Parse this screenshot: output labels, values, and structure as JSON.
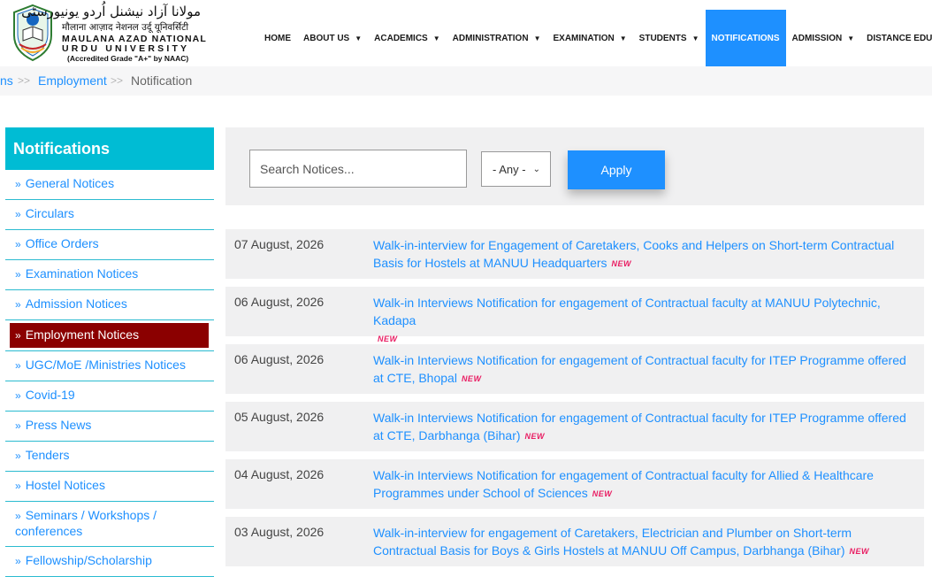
{
  "logo": {
    "urdu": "مولانا آزاد نیشنل اُردو یونیورسٹی",
    "hindi": "मौलाना आज़ाद नेशनल उर्दू यूनिवर्सिटी",
    "line1": "MAULANA AZAD NATIONAL",
    "line2": "URDU UNIVERSITY",
    "line3": "(Accredited Grade \"A+\" by NAAC)"
  },
  "nav": [
    {
      "label": "HOME",
      "dropdown": false
    },
    {
      "label": "ABOUT US",
      "dropdown": true
    },
    {
      "label": "ACADEMICS",
      "dropdown": true
    },
    {
      "label": "ADMINISTRATION",
      "dropdown": true
    },
    {
      "label": "EXAMINATION",
      "dropdown": true
    },
    {
      "label": "STUDENTS",
      "dropdown": true
    },
    {
      "label": "NOTIFICATIONS",
      "dropdown": false,
      "active": true
    },
    {
      "label": "ADMISSION",
      "dropdown": true
    },
    {
      "label": "DISTANCE EDUCATION",
      "dropdown": false
    }
  ],
  "breadcrumb": {
    "partial": "ns",
    "sep": ">>",
    "parent": "Employment",
    "current": "Notification"
  },
  "sidebar": {
    "title": "Notifications",
    "items": [
      "General Notices",
      "Circulars",
      "Office Orders",
      "Examination Notices",
      "Admission Notices",
      "Employment Notices",
      "UGC/MoE /Ministries Notices",
      "Covid-19",
      "Press News",
      "Tenders",
      "Hostel Notices",
      "Seminars / Workshops / conferences",
      "Fellowship/Scholarship"
    ],
    "active_index": 5
  },
  "filter": {
    "search_placeholder": "Search Notices...",
    "select_value": "- Any -",
    "apply_label": "Apply"
  },
  "new_badge": "NEW",
  "notices": [
    {
      "date": "07 August, 2026",
      "title": "Walk-in-interview for Engagement of Caretakers, Cooks and Helpers on Short-term Contractual Basis for Hostels at MANUU Headquarters"
    },
    {
      "date": "06 August, 2026",
      "title": "Walk-in Interviews Notification for engagement of Contractual faculty at MANUU Polytechnic, Kadapa"
    },
    {
      "date": "06 August, 2026",
      "title": "Walk-in Interviews Notification for engagement of Contractual faculty for ITEP Programme offered at CTE, Bhopal"
    },
    {
      "date": "05 August, 2026",
      "title": "Walk-in Interviews Notification for engagement of Contractual faculty for ITEP Programme offered at CTE, Darbhanga (Bihar)"
    },
    {
      "date": "04 August, 2026",
      "title": "Walk-in Interviews Notification for engagement of Contractual faculty for Allied & Healthcare Programmes under School of Sciences"
    },
    {
      "date": "03 August, 2026",
      "title": "Walk-in-interview for engagement of Caretakers, Electrician and Plumber on Short-term Contractual Basis for Boys & Girls Hostels at MANUU Off Campus, Darbhanga (Bihar)"
    }
  ],
  "colors": {
    "accent": "#1e90ff",
    "sidebar_head": "#00bcd4",
    "active_item": "#8b0000"
  }
}
